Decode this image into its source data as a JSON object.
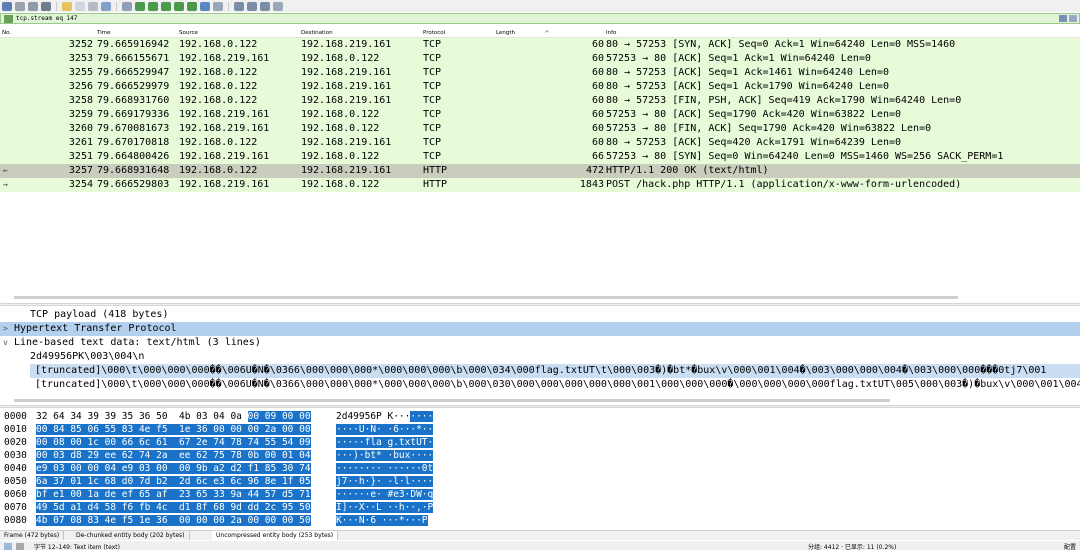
{
  "filter": {
    "value": "tcp.stream eq 147"
  },
  "columns": [
    "No.",
    "Time",
    "Source",
    "Destination",
    "Protocol",
    "Length",
    "Info"
  ],
  "packets": [
    {
      "no": "3252",
      "time": "79.665916942",
      "src": "192.168.0.122",
      "dst": "192.168.219.161",
      "proto": "TCP",
      "len": "60",
      "info": "80 → 57253 [SYN, ACK] Seq=0 Ack=1 Win=64240 Len=0 MSS=1460"
    },
    {
      "no": "3253",
      "time": "79.666155671",
      "src": "192.168.219.161",
      "dst": "192.168.0.122",
      "proto": "TCP",
      "len": "60",
      "info": "57253 → 80 [ACK] Seq=1 Ack=1 Win=64240 Len=0"
    },
    {
      "no": "3255",
      "time": "79.666529947",
      "src": "192.168.0.122",
      "dst": "192.168.219.161",
      "proto": "TCP",
      "len": "60",
      "info": "80 → 57253 [ACK] Seq=1 Ack=1461 Win=64240 Len=0"
    },
    {
      "no": "3256",
      "time": "79.666529979",
      "src": "192.168.0.122",
      "dst": "192.168.219.161",
      "proto": "TCP",
      "len": "60",
      "info": "80 → 57253 [ACK] Seq=1 Ack=1790 Win=64240 Len=0"
    },
    {
      "no": "3258",
      "time": "79.668931760",
      "src": "192.168.0.122",
      "dst": "192.168.219.161",
      "proto": "TCP",
      "len": "60",
      "info": "80 → 57253 [FIN, PSH, ACK] Seq=419 Ack=1790 Win=64240 Len=0"
    },
    {
      "no": "3259",
      "time": "79.669179336",
      "src": "192.168.219.161",
      "dst": "192.168.0.122",
      "proto": "TCP",
      "len": "60",
      "info": "57253 → 80 [ACK] Seq=1790 Ack=420 Win=63822 Len=0"
    },
    {
      "no": "3260",
      "time": "79.670081673",
      "src": "192.168.219.161",
      "dst": "192.168.0.122",
      "proto": "TCP",
      "len": "60",
      "info": "57253 → 80 [FIN, ACK] Seq=1790 Ack=420 Win=63822 Len=0"
    },
    {
      "no": "3261",
      "time": "79.670170818",
      "src": "192.168.0.122",
      "dst": "192.168.219.161",
      "proto": "TCP",
      "len": "60",
      "info": "80 → 57253 [ACK] Seq=420 Ack=1791 Win=64239 Len=0"
    },
    {
      "no": "3251",
      "time": "79.664800426",
      "src": "192.168.219.161",
      "dst": "192.168.0.122",
      "proto": "TCP",
      "len": "66",
      "info": "57253 → 80 [SYN] Seq=0 Win=64240 Len=0 MSS=1460 WS=256 SACK_PERM=1"
    },
    {
      "no": "3257",
      "time": "79.668931648",
      "src": "192.168.0.122",
      "dst": "192.168.219.161",
      "proto": "HTTP",
      "len": "472",
      "info": "HTTP/1.1 200 OK  (text/html)"
    },
    {
      "no": "3254",
      "time": "79.666529803",
      "src": "192.168.219.161",
      "dst": "192.168.0.122",
      "proto": "HTTP",
      "len": "1843",
      "info": "POST /hack.php HTTP/1.1  (application/x-www-form-urlencoded)"
    }
  ],
  "details": {
    "tcp_payload": "TCP payload (418 bytes)",
    "http": "Hypertext Transfer Protocol",
    "line_based": "Line-based text data: text/html (3 lines)",
    "line1": "2d49956PK\\003\\004\\n",
    "line2": "[truncated]\\000\\t\\000\\000\\000��\\006U�N�\\0366\\000\\000\\000*\\000\\000\\000\\b\\000\\034\\000flag.txtUT\\t\\000\\003�)�bt*�bux\\v\\000\\001\\004�\\003\\000\\000\\004�\\003\\000\\000���0tj7\\001",
    "line3": "[truncated]\\000\\t\\000\\000\\000��\\006U�N�\\0366\\000\\000\\000*\\000\\000\\000\\b\\000\\030\\000\\000\\000\\000\\000\\001\\000\\000\\000�\\000\\000\\000\\000flag.txtUT\\005\\000\\003�)�bux\\v\\000\\001\\004"
  },
  "bytes": [
    {
      "off": "0000",
      "hex_plain": "32 64 34 39 39 35 36 50  4b 03 04 0a ",
      "hex_sel": "00 09 00 00",
      "asc_plain": "2d49956P K···",
      "asc_sel": "····"
    },
    {
      "off": "0010",
      "hex_plain": "",
      "hex_sel": "00 84 85 06 55 83 4e f5  1e 36 00 00 00 2a 00 00",
      "asc_plain": "",
      "asc_sel": "····U·N· ·6···*··"
    },
    {
      "off": "0020",
      "hex_plain": "",
      "hex_sel": "00 08 00 1c 00 66 6c 61  67 2e 74 78 74 55 54 09",
      "asc_plain": "",
      "asc_sel": "·····fla g.txtUT·"
    },
    {
      "off": "0030",
      "hex_plain": "",
      "hex_sel": "00 03 d8 29 ee 62 74 2a  ee 62 75 78 0b 00 01 04",
      "asc_plain": "",
      "asc_sel": "···)·bt* ·bux····"
    },
    {
      "off": "0040",
      "hex_plain": "",
      "hex_sel": "e9 03 00 00 04 e9 03 00  00 9b a2 d2 f1 85 30 74",
      "asc_plain": "",
      "asc_sel": "········ ······0t"
    },
    {
      "off": "0050",
      "hex_plain": "",
      "hex_sel": "6a 37 01 1c 68 d0 7d b2  2d 6c e3 6c 96 8e 1f 05",
      "asc_plain": "",
      "asc_sel": "j7··h·}· -l·l····"
    },
    {
      "off": "0060",
      "hex_plain": "",
      "hex_sel": "bf e1 00 1a de ef 65 af  23 65 33 9a 44 57 d5 71",
      "asc_plain": "",
      "asc_sel": "······e· #e3·DW·q"
    },
    {
      "off": "0070",
      "hex_plain": "",
      "hex_sel": "49 5d a1 d4 58 f6 fb 4c  d1 8f 68 9d dd 2c 95 50",
      "asc_plain": "",
      "asc_sel": "I]··X··L ··h··,·P"
    },
    {
      "off": "0080",
      "hex_plain": "",
      "hex_sel": "4b 07 08 83 4e f5 1e 36  00 00 00 2a 00 00 00 50",
      "asc_plain": "",
      "asc_sel": "K···N·6 ···*···P"
    }
  ],
  "tabs": [
    "Frame (472 bytes)",
    "De-chunked entity body (202 bytes)",
    "Uncompressed entity body (253 bytes)"
  ],
  "status": {
    "left": "字节 12–149: Text item (text)",
    "right": "分组: 4412 · 已显示: 11 (0.2%)",
    "far_right": "配置"
  },
  "colors": {
    "tcp_row": "#e7fbd9",
    "selected_row": "#c9cdbd",
    "byte_sel": "#1a73c8",
    "detail_hl": "#b3d0ee"
  }
}
